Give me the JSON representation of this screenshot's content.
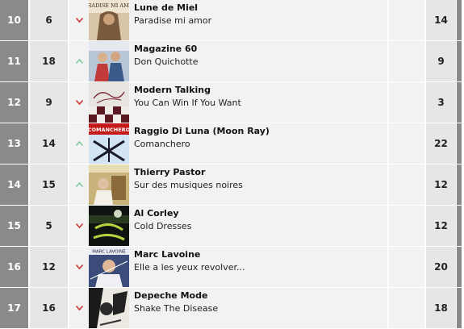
{
  "colors": {
    "rank_bg": "#8a8a8a",
    "cell_bg": "#f2f2f2",
    "number_bg": "#e6e6e6",
    "trend_up": "#7fc99a",
    "trend_down": "#cc3333"
  },
  "rows": [
    {
      "rank": "10",
      "last": "6",
      "trend": "down",
      "trend_icon": "arrow-down-icon",
      "artist": "Lune de Miel",
      "title": "Paradise mi amor",
      "weeks": "14",
      "cover_text": "PARADISE MI AMOR"
    },
    {
      "rank": "11",
      "last": "18",
      "trend": "up",
      "trend_icon": "arrow-up-icon",
      "artist": "Magazine 60",
      "title": "Don Quichotte",
      "weeks": "9",
      "cover_text": ""
    },
    {
      "rank": "12",
      "last": "9",
      "trend": "down",
      "trend_icon": "arrow-down-icon",
      "artist": "Modern Talking",
      "title": "You Can Win If You Want",
      "weeks": "3",
      "cover_text": ""
    },
    {
      "rank": "13",
      "last": "14",
      "trend": "up",
      "trend_icon": "arrow-up-icon",
      "artist": "Raggio Di Luna (Moon Ray)",
      "title": "Comanchero",
      "weeks": "22",
      "cover_text": "COMANCHERO"
    },
    {
      "rank": "14",
      "last": "15",
      "trend": "up",
      "trend_icon": "arrow-up-icon",
      "artist": "Thierry Pastor",
      "title": "Sur des musiques noires",
      "weeks": "12",
      "cover_text": ""
    },
    {
      "rank": "15",
      "last": "5",
      "trend": "down",
      "trend_icon": "arrow-down-icon",
      "artist": "Al Corley",
      "title": "Cold Dresses",
      "weeks": "12",
      "cover_text": ""
    },
    {
      "rank": "16",
      "last": "12",
      "trend": "down",
      "trend_icon": "arrow-down-icon",
      "artist": "Marc Lavoine",
      "title": "Elle a les yeux revolver...",
      "weeks": "20",
      "cover_text": "MARC LAVOINE"
    },
    {
      "rank": "17",
      "last": "16",
      "trend": "down",
      "trend_icon": "arrow-down-icon",
      "artist": "Depeche Mode",
      "title": "Shake The Disease",
      "weeks": "18",
      "cover_text": ""
    }
  ]
}
